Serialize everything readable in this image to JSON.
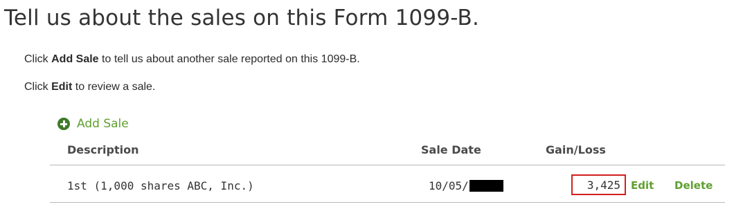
{
  "page": {
    "title": "Tell us about the sales on this Form 1099-B."
  },
  "instructions": {
    "line1_prefix": "Click ",
    "line1_bold": "Add Sale",
    "line1_suffix": " to tell us about another sale reported on this 1099-B.",
    "line2_prefix": "Click ",
    "line2_bold": "Edit",
    "line2_suffix": " to review a sale."
  },
  "add_sale": {
    "label": "Add Sale",
    "icon": "plus-circle-icon",
    "icon_color": "#3e7a2b",
    "label_color": "#5f9f2f"
  },
  "table": {
    "columns": [
      "Description",
      "Sale Date",
      "Gain/Loss"
    ],
    "rows": [
      {
        "description": "1st (1,000 shares ABC, Inc.)",
        "sale_date_visible": "10/05/",
        "gain_loss": "3,425",
        "edit_label": "Edit",
        "delete_label": "Delete"
      }
    ]
  },
  "colors": {
    "link_green": "#5f9f2f",
    "highlight_border": "#d21f1f",
    "redaction": "#000000"
  }
}
